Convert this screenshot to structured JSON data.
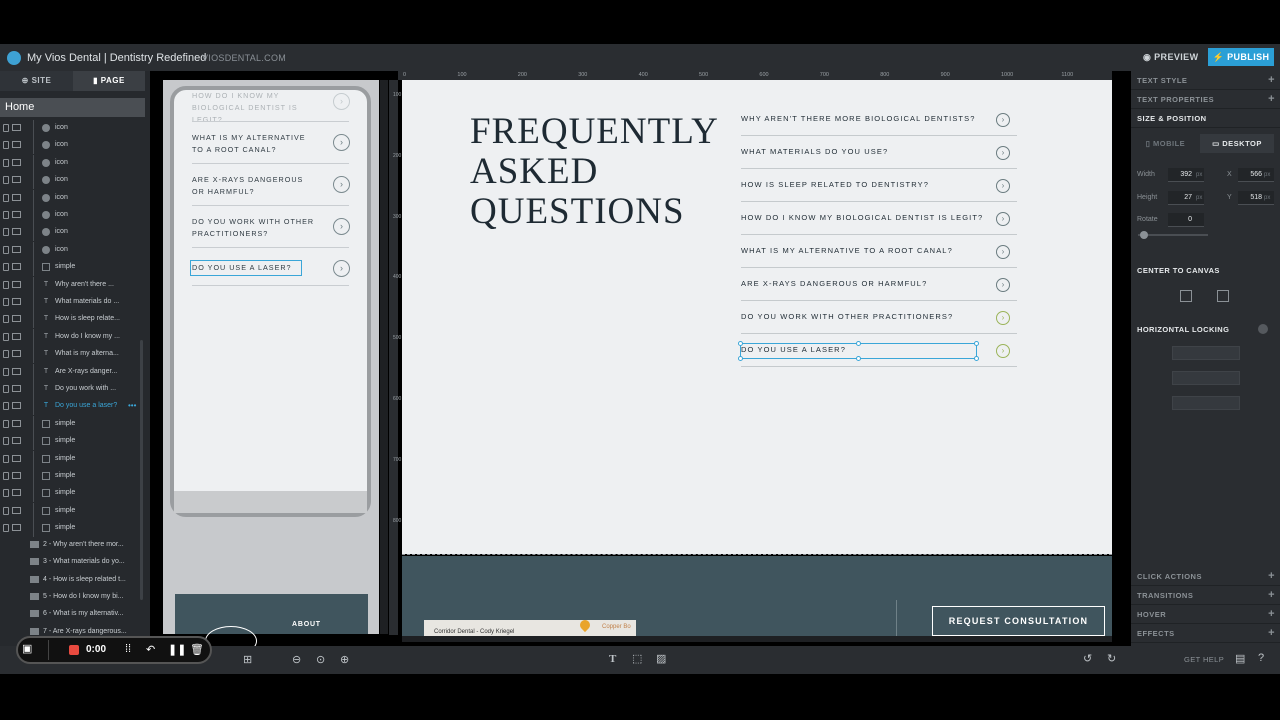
{
  "header": {
    "app_title": "My Vios Dental | Dentistry Redefined",
    "domain": "VIOSDENTAL.COM",
    "preview_label": "PREVIEW",
    "publish_label": "PUBLISH"
  },
  "left_panel": {
    "tabs": [
      "SITE",
      "PAGE"
    ],
    "page_name": "Home",
    "layers": [
      {
        "icon": "circle",
        "label": "icon"
      },
      {
        "icon": "circle",
        "label": "icon"
      },
      {
        "icon": "circle",
        "label": "icon"
      },
      {
        "icon": "circle",
        "label": "icon"
      },
      {
        "icon": "circle",
        "label": "icon"
      },
      {
        "icon": "circle",
        "label": "icon"
      },
      {
        "icon": "circle",
        "label": "icon"
      },
      {
        "icon": "circle",
        "label": "icon"
      },
      {
        "icon": "box",
        "label": "simple"
      },
      {
        "icon": "text",
        "label": "Why aren't there ..."
      },
      {
        "icon": "text",
        "label": "What materials do ..."
      },
      {
        "icon": "text",
        "label": "How is sleep relate..."
      },
      {
        "icon": "text",
        "label": "How do I know my ..."
      },
      {
        "icon": "text",
        "label": "What is my alterna..."
      },
      {
        "icon": "text",
        "label": "Are X-rays danger..."
      },
      {
        "icon": "text",
        "label": "Do you work with ..."
      },
      {
        "icon": "text",
        "label": "Do you use a laser?",
        "selected": true
      },
      {
        "icon": "box",
        "label": "simple"
      },
      {
        "icon": "box",
        "label": "simple"
      },
      {
        "icon": "box",
        "label": "simple"
      },
      {
        "icon": "box",
        "label": "simple"
      },
      {
        "icon": "box",
        "label": "simple"
      },
      {
        "icon": "box",
        "label": "simple"
      },
      {
        "icon": "box",
        "label": "simple"
      }
    ],
    "folders": [
      "2 - Why aren't there mor...",
      "3 - What materials do yo...",
      "4 - How is sleep related t...",
      "5 - How do I know my bi...",
      "6 - What is my alternativ...",
      "7 - Are X-rays dangerous..."
    ]
  },
  "mobile_preview": {
    "questions": [
      "HOW DO I KNOW MY BIOLOGICAL DENTIST IS LEGIT?",
      "WHAT IS MY ALTERNATIVE TO A ROOT CANAL?",
      "ARE X-RAYS DANGEROUS OR HARMFUL?",
      "DO YOU WORK WITH OTHER PRACTITIONERS?",
      "DO YOU USE A LASER?"
    ],
    "footer_link": "ABOUT"
  },
  "rulers": {
    "top": [
      "0",
      "100",
      "200",
      "300",
      "400",
      "500",
      "600",
      "700",
      "800",
      "900",
      "1000",
      "1100"
    ],
    "left": [
      "100",
      "200",
      "300",
      "400",
      "500",
      "600",
      "700",
      "800"
    ]
  },
  "canvas": {
    "headline": "FREQUENTLY ASKED QUESTIONS",
    "headline_lines": [
      "FREQUENTLY",
      "ASKED",
      "QUESTIONS"
    ],
    "questions": [
      "WHY AREN'T THERE MORE BIOLOGICAL DENTISTS?",
      "WHAT MATERIALS DO YOU USE?",
      "HOW IS SLEEP RELATED TO DENTISTRY?",
      "HOW DO I KNOW MY BIOLOGICAL DENTIST IS LEGIT?",
      "WHAT IS MY ALTERNATIVE TO A ROOT CANAL?",
      "ARE X-RAYS DANGEROUS OR HARMFUL?",
      "DO YOU WORK WITH OTHER PRACTITIONERS?",
      "DO YOU USE A LASER?"
    ],
    "arrow_glyph": "›",
    "request_button": "REQUEST CONSULTATION",
    "map_label": "Corridor Dental - Cody Kriegel",
    "map_label2": "Copper Bo"
  },
  "right_panel": {
    "sections_top": [
      "TEXT STYLE",
      "TEXT PROPERTIES"
    ],
    "active_section": "SIZE & POSITION",
    "device_tabs": [
      "MOBILE",
      "DESKTOP"
    ],
    "width_label": "Width",
    "width_value": "392",
    "height_label": "Height",
    "height_value": "27",
    "x_label": "X",
    "x_value": "566",
    "y_label": "Y",
    "y_value": "518",
    "rotate_label": "Rotate",
    "rotate_value": "0",
    "unit": "px",
    "center_label": "CENTER TO CANVAS",
    "horizontal_locking_label": "HORIZONTAL LOCKING",
    "sections_bottom": [
      "CLICK ACTIONS",
      "TRANSITIONS",
      "HOVER",
      "EFFECTS"
    ]
  },
  "recorder": {
    "time": "0:00"
  },
  "footer_bar": {
    "get_help": "GET HELP"
  },
  "colors": {
    "accent": "#3aa6d8",
    "publish": "#2b9fd6",
    "footer": "#40555e",
    "canvas_bg": "#eef0f2"
  }
}
